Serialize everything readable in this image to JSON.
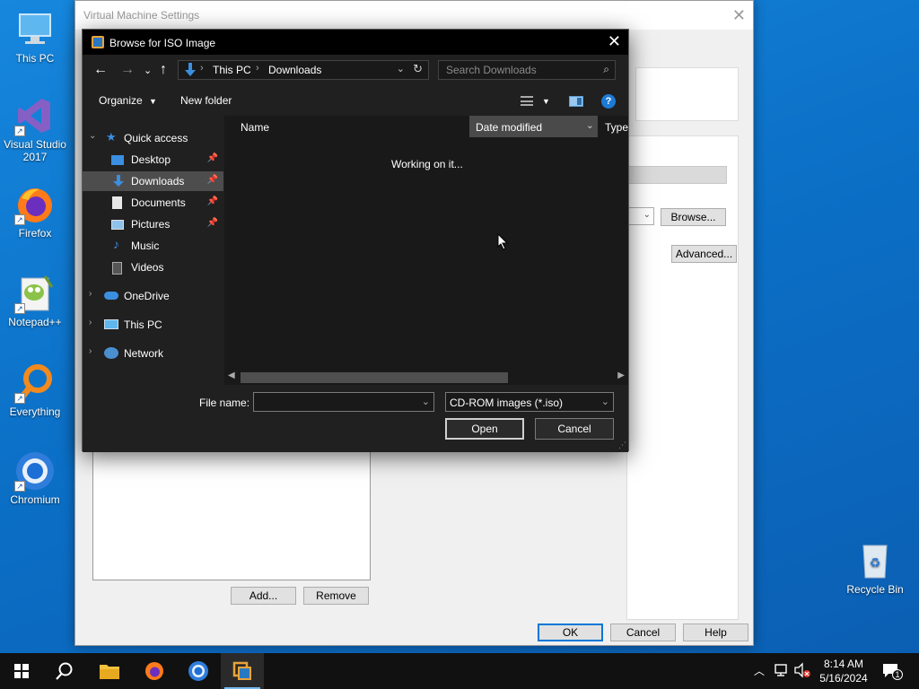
{
  "desktop": {
    "icons": [
      {
        "label": "This PC"
      },
      {
        "label": "Visual Studio 2017"
      },
      {
        "label": "Firefox"
      },
      {
        "label": "Notepad++"
      },
      {
        "label": "Everything"
      },
      {
        "label": "Chromium"
      },
      {
        "label": "Recycle Bin"
      }
    ]
  },
  "vm_window": {
    "title": "Virtual Machine Settings",
    "browse_label": "Browse...",
    "advanced_label": "Advanced...",
    "add_label": "Add...",
    "remove_label": "Remove",
    "ok_label": "OK",
    "cancel_label": "Cancel",
    "help_label": "Help"
  },
  "dialog": {
    "title": "Browse for ISO Image",
    "breadcrumb": [
      "This PC",
      "Downloads"
    ],
    "search_placeholder": "Search Downloads",
    "organize_label": "Organize",
    "new_folder_label": "New folder",
    "nav": {
      "quick_access": "Quick access",
      "desktop": "Desktop",
      "downloads": "Downloads",
      "documents": "Documents",
      "pictures": "Pictures",
      "music": "Music",
      "videos": "Videos",
      "onedrive": "OneDrive",
      "this_pc": "This PC",
      "network": "Network"
    },
    "columns": {
      "name": "Name",
      "date_modified": "Date modified",
      "type": "Type"
    },
    "status_text": "Working on it...",
    "file_name_label": "File name:",
    "file_name_value": "",
    "file_type": "CD-ROM images (*.iso)",
    "open_label": "Open",
    "cancel_label": "Cancel"
  },
  "taskbar": {
    "time": "8:14 AM",
    "date": "5/16/2024",
    "notification_count": "1"
  }
}
